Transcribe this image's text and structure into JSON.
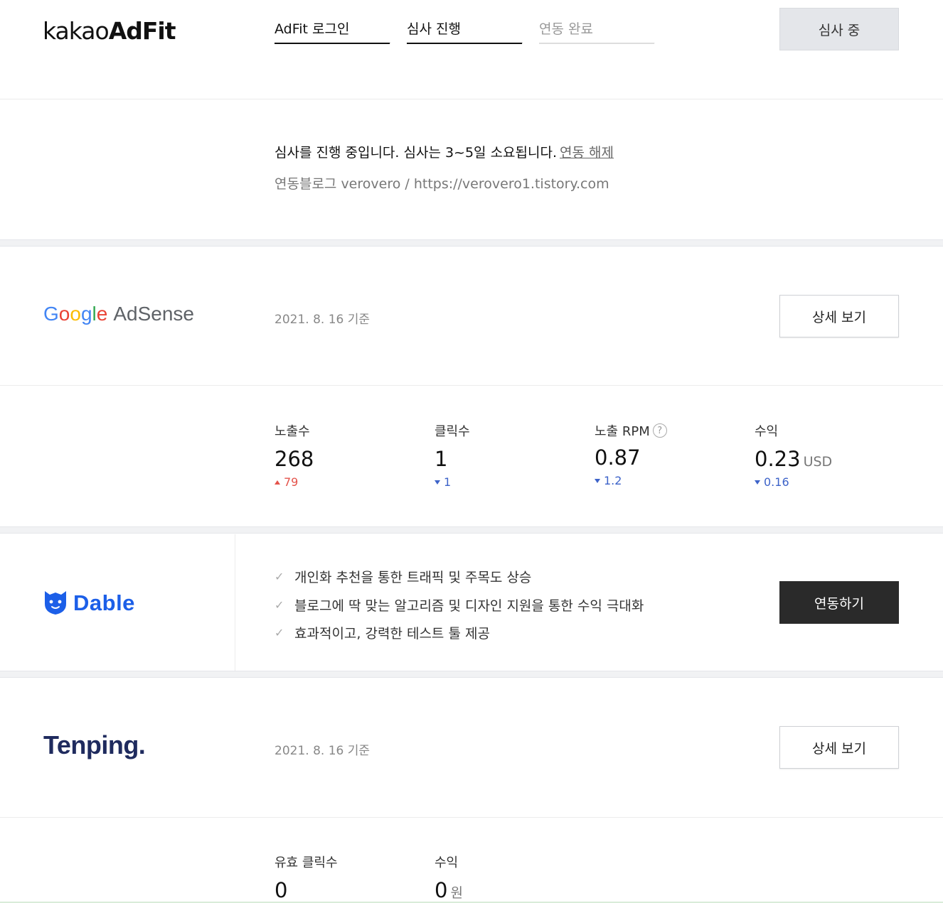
{
  "kakao": {
    "logo_light": "kakao",
    "logo_bold": "AdFit",
    "steps": [
      {
        "label": "AdFit 로그인",
        "state": "done"
      },
      {
        "label": "심사 진행",
        "state": "done"
      },
      {
        "label": "연동 완료",
        "state": "todo"
      }
    ],
    "review_button": "심사 중",
    "status_message": "심사를 진행 중입니다. 심사는 3~5일 소요됩니다.",
    "unlink_label": "연동 해제",
    "blog_info": "연동블로그 verovero / https://verovero1.tistory.com"
  },
  "adsense": {
    "logo_letters": [
      "G",
      "o",
      "o",
      "g",
      "l",
      "e"
    ],
    "logo_product": "AdSense",
    "as_of": "2021. 8. 16 기준",
    "detail_button": "상세 보기",
    "metrics": [
      {
        "label": "노출수",
        "value": "268",
        "unit": "",
        "delta": "79",
        "direction": "up",
        "help": false
      },
      {
        "label": "클릭수",
        "value": "1",
        "unit": "",
        "delta": "1",
        "direction": "down",
        "help": false
      },
      {
        "label": "노출 RPM",
        "value": "0.87",
        "unit": "",
        "delta": "1.2",
        "direction": "down",
        "help": true
      },
      {
        "label": "수익",
        "value": "0.23",
        "unit": "USD",
        "delta": "0.16",
        "direction": "down",
        "help": false
      }
    ]
  },
  "dable": {
    "logo_text": "Dable",
    "features": [
      "개인화 추천을 통한 트래픽 및 주목도 상승",
      "블로그에 딱 맞는 알고리즘 및 디자인 지원을 통한 수익 극대화",
      "효과적이고, 강력한 테스트 툴 제공"
    ],
    "connect_button": "연동하기"
  },
  "tenping": {
    "logo_text": "Tenping.",
    "as_of": "2021. 8. 16 기준",
    "detail_button": "상세 보기",
    "metrics": [
      {
        "label": "유효 클릭수",
        "value": "0",
        "unit": ""
      },
      {
        "label": "수익",
        "value": "0",
        "unit": "원"
      }
    ]
  },
  "colors": {
    "google_blue": "#4285F4",
    "google_red": "#EA4335",
    "google_yellow": "#FBBC05",
    "google_green": "#34A853",
    "dable_blue": "#1c5fe8",
    "tenping_navy": "#1f2b5e",
    "delta_up": "#e4534b",
    "delta_down": "#3d63c9"
  }
}
